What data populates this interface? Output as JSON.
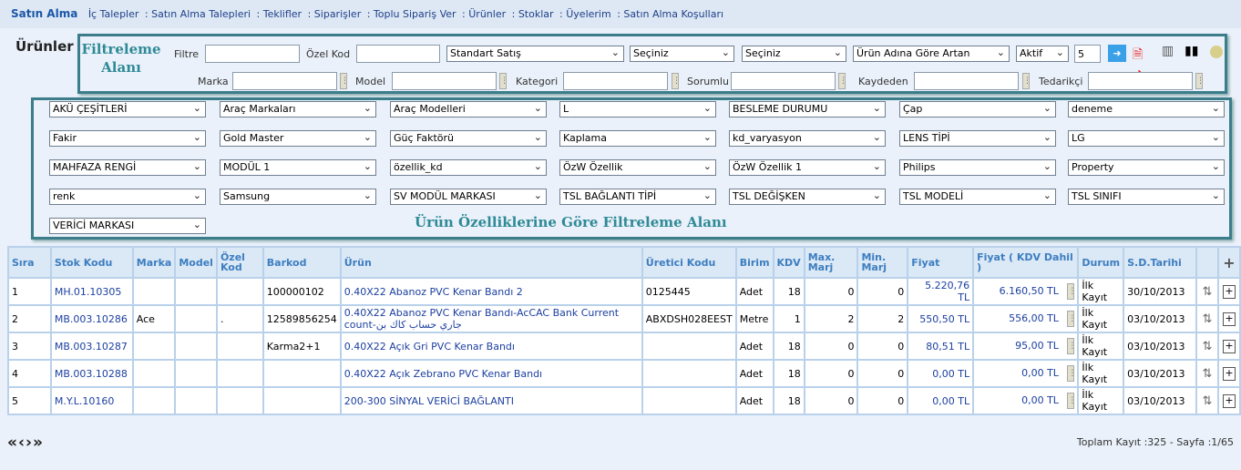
{
  "nav": {
    "brand": "Satın Alma",
    "items": [
      "İç Talepler",
      "Satın Alma Talepleri",
      "Teklifler",
      "Siparişler",
      "Toplu Sipariş Ver",
      "Ürünler",
      "Stoklar",
      "Üyelerim",
      "Satın Alma Koşulları"
    ]
  },
  "page_title": "Ürünler",
  "filter_area_label": "Filtreleme Alanı",
  "attribute_area_label": "Ürün Özelliklerine Göre Filtreleme Alanı",
  "filter": {
    "filtre_label": "Filtre",
    "filtre_value": "",
    "ozel_kod_label": "Özel Kod",
    "ozel_kod_value": "",
    "sales_type": "Standart Satış",
    "select2": "Seçiniz",
    "select3": "Seçiniz",
    "sort": "Ürün Adına Göre Artan",
    "status": "Aktif",
    "page_size": "5",
    "marka_label": "Marka",
    "model_label": "Model",
    "kategori_label": "Kategori",
    "sorumlu_label": "Sorumlu",
    "kaydeden_label": "Kaydeden",
    "tedarikci_label": "Tedarikçi"
  },
  "attributes": [
    "AKÜ ÇEŞİTLERİ",
    "Araç Markaları",
    "Araç Modelleri",
    "L",
    "BESLEME DURUMU",
    "Çap",
    "deneme",
    "Fakir",
    "Gold Master",
    "Güç Faktörü",
    "Kaplama",
    "kd_varyasyon",
    "LENS TİPİ",
    "LG",
    "MAHFAZA RENGİ",
    "MODÜL 1",
    "özellik_kd",
    "ÖzW Özellik",
    "ÖzW Özellik 1",
    "Philips",
    "Property",
    "renk",
    "Samsung",
    "SV MODÜL MARKASI",
    "TSL BAĞLANTI TİPİ",
    "TSL DEĞİŞKEN",
    "TSL MODELİ",
    "TSL SINIFI",
    "VERİCİ MARKASI"
  ],
  "table": {
    "headers": [
      "Sıra",
      "Stok Kodu",
      "Marka",
      "Model",
      "Özel Kod",
      "Barkod",
      "Ürün",
      "Üretici Kodu",
      "Birim",
      "KDV",
      "Max. Marj",
      "Min. Marj",
      "Fiyat",
      "Fiyat ( KDV Dahil )",
      "Durum",
      "S.D.Tarihi",
      "",
      "+"
    ],
    "rows": [
      [
        "1",
        "MH.01.10305",
        "",
        "",
        "",
        "100000102",
        "0.40X22 Abanoz PVC Kenar Bandı 2",
        "0125445",
        "Adet",
        "18",
        "0",
        "0",
        "5.220,76 TL",
        "6.160,50 TL",
        "İlk Kayıt",
        "30/10/2013"
      ],
      [
        "2",
        "MB.003.10286",
        "Ace",
        "",
        ".",
        "12589856254",
        "0.40X22 Abanoz PVC Kenar Bandı-AcCAC Bank Current count-جاري حساب كاك بن",
        "ABXDSH028EEST",
        "Metre",
        "1",
        "2",
        "2",
        "550,50 TL",
        "556,00 TL",
        "İlk Kayıt",
        "03/10/2013"
      ],
      [
        "3",
        "MB.003.10287",
        "",
        "",
        "",
        "Karma2+1",
        "0.40X22 Açık Gri PVC Kenar Bandı",
        "",
        "Adet",
        "18",
        "0",
        "0",
        "80,51 TL",
        "95,00 TL",
        "İlk Kayıt",
        "03/10/2013"
      ],
      [
        "4",
        "MB.003.10288",
        "",
        "",
        "",
        "",
        "0.40X22 Açık Zebrano PVC Kenar Bandı",
        "",
        "Adet",
        "18",
        "0",
        "0",
        "0,00 TL",
        "0,00 TL",
        "İlk Kayıt",
        "03/10/2013"
      ],
      [
        "5",
        "M.Y.L.10160",
        "",
        "",
        "",
        "",
        "200-300 SİNYAL VERİCİ BAĞLANTI",
        "",
        "Adet",
        "18",
        "0",
        "0",
        "0,00 TL",
        "0,00 TL",
        "İlk Kayıt",
        "03/10/2013"
      ]
    ]
  },
  "pager": {
    "symbols": "«‹›»",
    "total": "Toplam Kayıt :325 -  Sayfa :1/65"
  }
}
